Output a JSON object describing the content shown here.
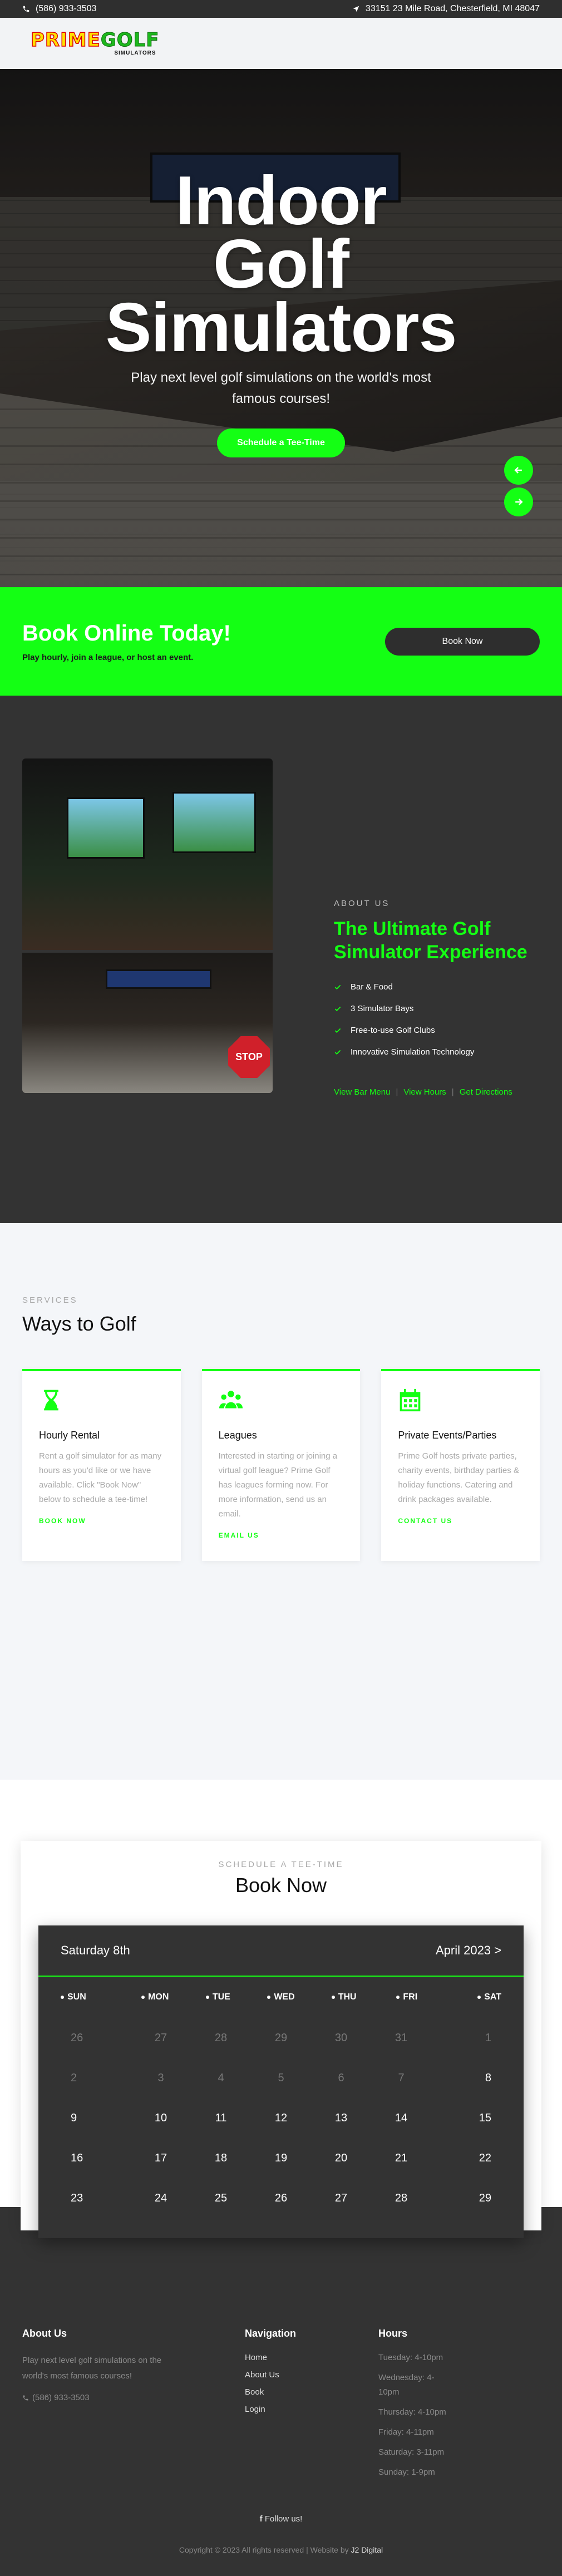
{
  "topbar": {
    "phone": "(586) 933-3503",
    "address": "33151 23 Mile Road, Chesterfield, MI 48047"
  },
  "logo": {
    "word1": "PRIME",
    "word2": "GOLF",
    "tagline": "SIMULATORS"
  },
  "hero": {
    "line1": "Indoor",
    "line2": "Golf",
    "line3": "Simulators",
    "subtitle": "Play next level golf simulations on the world's most famous courses!",
    "button": "Schedule a Tee-Time"
  },
  "cta": {
    "title": "Book Online Today!",
    "subtitle": "Play hourly, join a league, or host an event.",
    "button": "Book Now"
  },
  "about": {
    "eyebrow": "ABOUT US",
    "title": "The Ultimate Golf Simulator Experience",
    "features": [
      "Bar & Food",
      "3 Simulator Bays",
      "Free-to-use Golf Clubs",
      "Innovative Simulation Technology"
    ],
    "links": [
      "View Bar Menu",
      "View Hours",
      "Get Directions"
    ],
    "stop_sign": "STOP"
  },
  "services": {
    "eyebrow": "SERVICES",
    "title": "Ways to Golf",
    "cards": [
      {
        "title": "Hourly Rental",
        "text": "Rent a golf simulator for as many hours as you'd like or we have available. Click \"Book Now\" below to schedule a tee-time!",
        "link": "BOOK NOW",
        "icon": "hourglass-icon"
      },
      {
        "title": "Leagues",
        "text": "Interested in starting or joining a virtual golf league? Prime Golf has leagues forming now. For more information, send us an email.",
        "link": "EMAIL US",
        "icon": "group-icon"
      },
      {
        "title": "Private Events/Parties",
        "text": "Prime Golf hosts private parties, charity events, birthday parties & holiday functions. Catering and drink packages available.",
        "link": "CONTACT US",
        "icon": "calendar-icon"
      }
    ]
  },
  "booking": {
    "eyebrow": "SCHEDULE A TEE-TIME",
    "title": "Book Now",
    "calendar": {
      "selected_day": "Saturday 8th",
      "month": "April 2023 >",
      "days_of_week": [
        "SUN",
        "MON",
        "TUE",
        "WED",
        "THU",
        "FRI",
        "SAT"
      ],
      "weeks": [
        [
          {
            "d": "26",
            "dim": true
          },
          {
            "d": "27",
            "dim": true
          },
          {
            "d": "28",
            "dim": true
          },
          {
            "d": "29",
            "dim": true
          },
          {
            "d": "30",
            "dim": true
          },
          {
            "d": "31",
            "dim": true
          },
          {
            "d": "1",
            "dim": true
          }
        ],
        [
          {
            "d": "2",
            "dim": true
          },
          {
            "d": "3",
            "dim": true
          },
          {
            "d": "4",
            "dim": true
          },
          {
            "d": "5",
            "dim": true
          },
          {
            "d": "6",
            "dim": true
          },
          {
            "d": "7",
            "dim": true
          },
          {
            "d": "8",
            "dim": false
          }
        ],
        [
          {
            "d": "9",
            "dim": false
          },
          {
            "d": "10",
            "dim": false
          },
          {
            "d": "11",
            "dim": false
          },
          {
            "d": "12",
            "dim": false
          },
          {
            "d": "13",
            "dim": false
          },
          {
            "d": "14",
            "dim": false
          },
          {
            "d": "15",
            "dim": false
          }
        ],
        [
          {
            "d": "16",
            "dim": false
          },
          {
            "d": "17",
            "dim": false
          },
          {
            "d": "18",
            "dim": false
          },
          {
            "d": "19",
            "dim": false
          },
          {
            "d": "20",
            "dim": false
          },
          {
            "d": "21",
            "dim": false
          },
          {
            "d": "22",
            "dim": false
          }
        ],
        [
          {
            "d": "23",
            "dim": false
          },
          {
            "d": "24",
            "dim": false
          },
          {
            "d": "25",
            "dim": false
          },
          {
            "d": "26",
            "dim": false
          },
          {
            "d": "27",
            "dim": false
          },
          {
            "d": "28",
            "dim": false
          },
          {
            "d": "29",
            "dim": false
          }
        ]
      ]
    }
  },
  "footer": {
    "about_title": "About Us",
    "about_text": "Play next level golf simulations on the world's most famous courses!",
    "phone": "(586) 933-3503",
    "nav_title": "Navigation",
    "nav": [
      "Home",
      "About Us",
      "Book",
      "Login"
    ],
    "hours_title": "Hours",
    "hours": [
      "Tuesday: 4-10pm",
      "Wednesday: 4-10pm",
      "Thursday: 4-10pm",
      "Friday: 4-11pm",
      "Saturday: 3-11pm",
      "Sunday: 1-9pm"
    ],
    "follow": "Follow us!",
    "copyright": "Copyright © 2023 All rights reserved | Website by ",
    "brand": "J2 Digital"
  },
  "colors": {
    "accent": "#14ff14",
    "dark": "#333333",
    "topbar": "#2f2f2f"
  }
}
